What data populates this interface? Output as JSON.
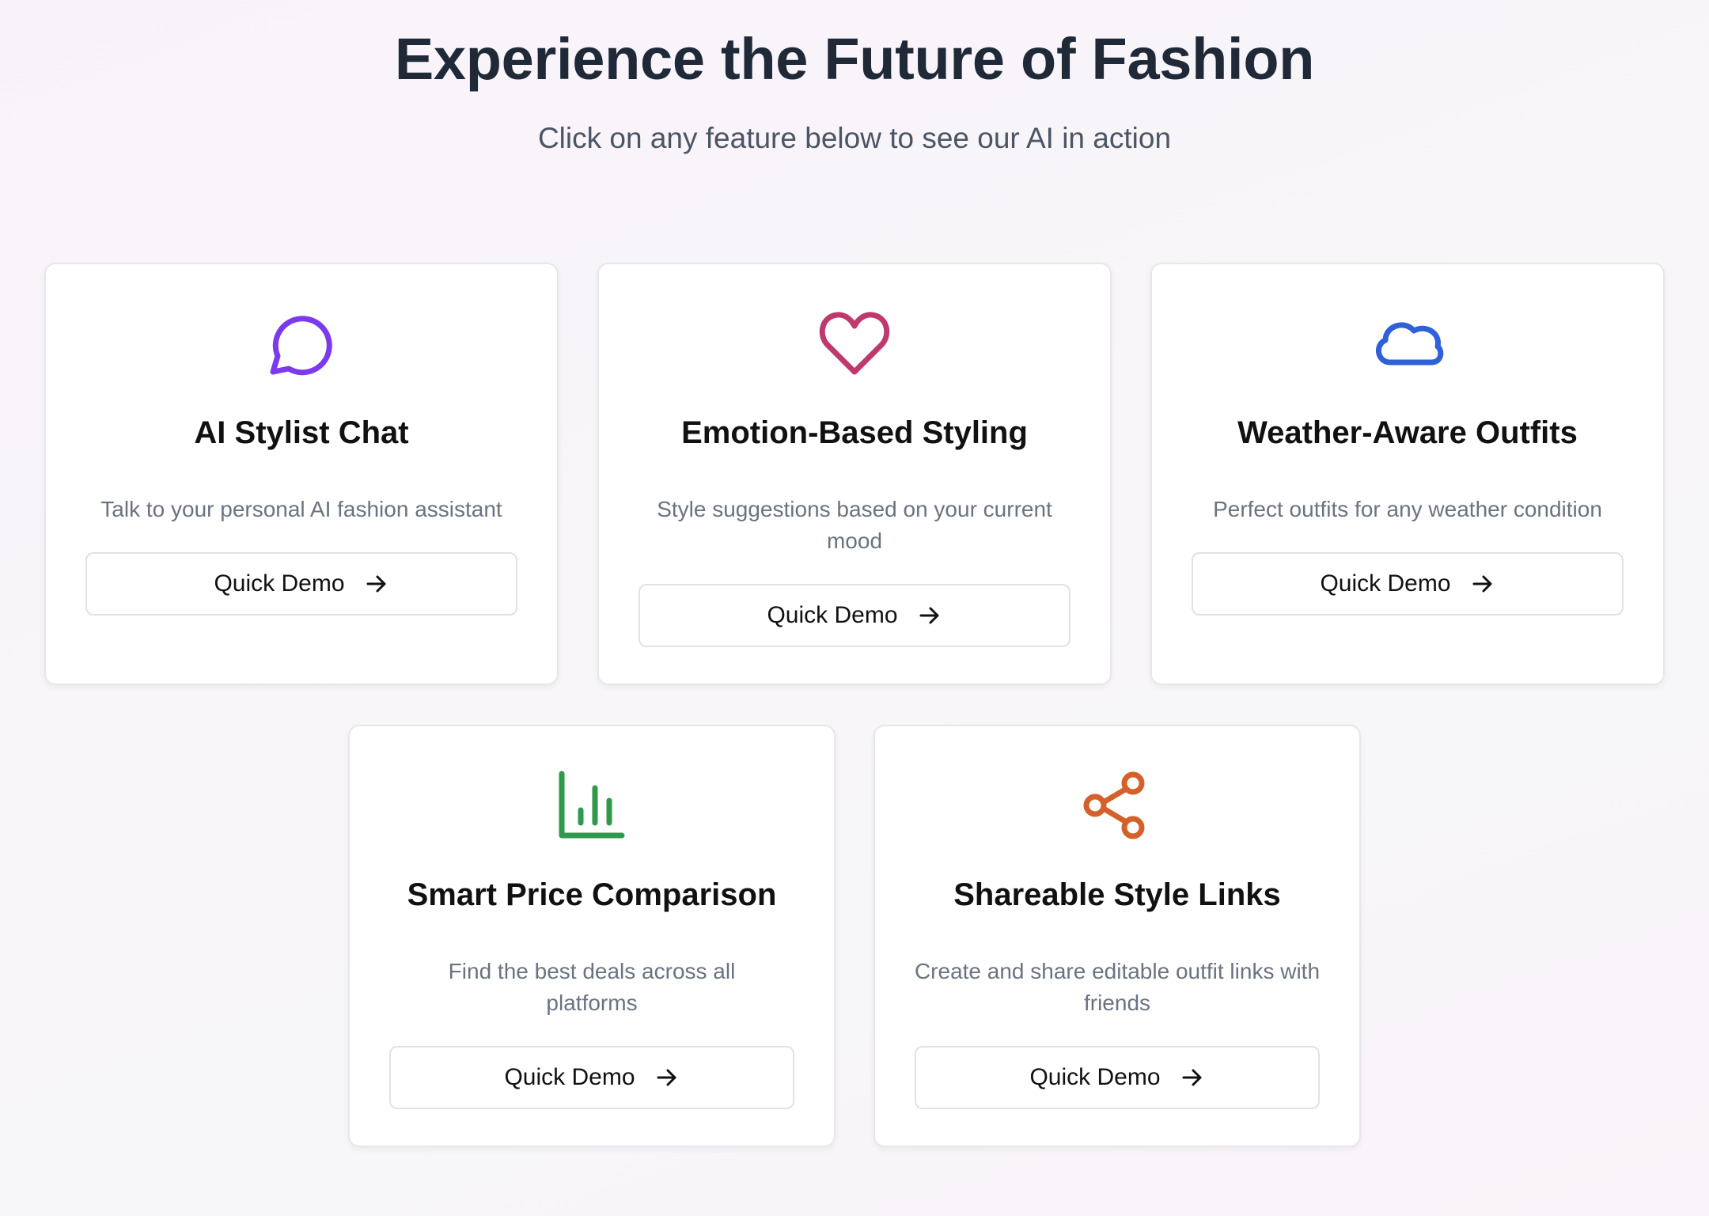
{
  "hero": {
    "title": "Experience the Future of Fashion",
    "subtitle": "Click on any feature below to see our AI in action"
  },
  "features": [
    {
      "icon": "chat-bubble-icon",
      "icon_color": "#7c3aed",
      "title": "AI Stylist Chat",
      "description": "Talk to your personal AI fashion assistant",
      "button_label": "Quick Demo"
    },
    {
      "icon": "heart-icon",
      "icon_color": "#be3a6e",
      "title": "Emotion-Based Styling",
      "description": "Style suggestions based on your current mood",
      "button_label": "Quick Demo"
    },
    {
      "icon": "cloud-icon",
      "icon_color": "#2f5fd9",
      "title": "Weather-Aware Outfits",
      "description": "Perfect outfits for any weather condition",
      "button_label": "Quick Demo"
    },
    {
      "icon": "bar-chart-icon",
      "icon_color": "#2e9a4a",
      "title": "Smart Price Comparison",
      "description": "Find the best deals across all platforms",
      "button_label": "Quick Demo"
    },
    {
      "icon": "share-icon",
      "icon_color": "#d4612b",
      "title": "Shareable Style Links",
      "description": "Create and share editable outfit links with friends",
      "button_label": "Quick Demo"
    }
  ]
}
